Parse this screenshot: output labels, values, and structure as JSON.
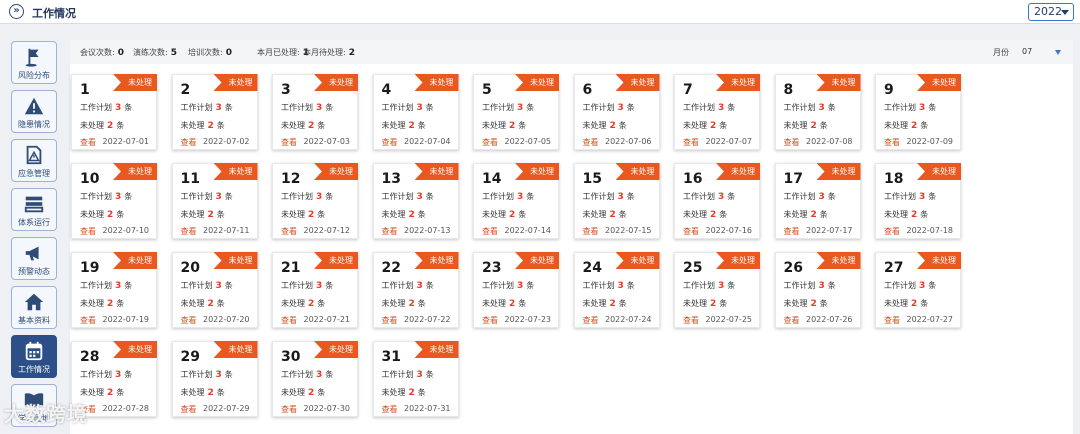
{
  "header": {
    "title": "工作情况",
    "year": "2022"
  },
  "sidebar": [
    {
      "label": "风险分布",
      "icon": "flag-icon"
    },
    {
      "label": "隐患情况",
      "icon": "warning-icon"
    },
    {
      "label": "应急管理",
      "icon": "document-alert-icon"
    },
    {
      "label": "体系运行",
      "icon": "server-stack-icon"
    },
    {
      "label": "预警动态",
      "icon": "megaphone-icon"
    },
    {
      "label": "基本资料",
      "icon": "home-icon"
    },
    {
      "label": "工作情况",
      "icon": "calendar-icon",
      "active": true
    },
    {
      "label": "学习园地",
      "icon": "book-icon"
    }
  ],
  "stats": [
    {
      "label": "会议次数:",
      "value": "0"
    },
    {
      "label": "演练次数:",
      "value": "5"
    },
    {
      "label": "培训次数:",
      "value": "0"
    },
    {
      "label": "本月已处理:",
      "value": "1"
    },
    {
      "label": "本月待处理:",
      "value": "2"
    }
  ],
  "month": {
    "label": "月份",
    "value": "07"
  },
  "card_text": {
    "badge": "未处理",
    "plan_prefix": "工作计划",
    "unit": "条",
    "pending_prefix": "未处理",
    "view": "查看"
  },
  "days": [
    {
      "day": "1",
      "plan": "3",
      "pending": "2",
      "date": "2022-07-01"
    },
    {
      "day": "2",
      "plan": "3",
      "pending": "2",
      "date": "2022-07-02"
    },
    {
      "day": "3",
      "plan": "3",
      "pending": "2",
      "date": "2022-07-03"
    },
    {
      "day": "4",
      "plan": "3",
      "pending": "2",
      "date": "2022-07-04"
    },
    {
      "day": "5",
      "plan": "3",
      "pending": "2",
      "date": "2022-07-05"
    },
    {
      "day": "6",
      "plan": "3",
      "pending": "2",
      "date": "2022-07-06"
    },
    {
      "day": "7",
      "plan": "3",
      "pending": "2",
      "date": "2022-07-07"
    },
    {
      "day": "8",
      "plan": "3",
      "pending": "2",
      "date": "2022-07-08"
    },
    {
      "day": "9",
      "plan": "3",
      "pending": "2",
      "date": "2022-07-09"
    },
    {
      "day": "10",
      "plan": "3",
      "pending": "2",
      "date": "2022-07-10"
    },
    {
      "day": "11",
      "plan": "3",
      "pending": "2",
      "date": "2022-07-11"
    },
    {
      "day": "12",
      "plan": "3",
      "pending": "2",
      "date": "2022-07-12"
    },
    {
      "day": "13",
      "plan": "3",
      "pending": "2",
      "date": "2022-07-13"
    },
    {
      "day": "14",
      "plan": "3",
      "pending": "2",
      "date": "2022-07-14"
    },
    {
      "day": "15",
      "plan": "3",
      "pending": "2",
      "date": "2022-07-15"
    },
    {
      "day": "16",
      "plan": "3",
      "pending": "2",
      "date": "2022-07-16"
    },
    {
      "day": "17",
      "plan": "3",
      "pending": "2",
      "date": "2022-07-17"
    },
    {
      "day": "18",
      "plan": "3",
      "pending": "2",
      "date": "2022-07-18"
    },
    {
      "day": "19",
      "plan": "3",
      "pending": "2",
      "date": "2022-07-19"
    },
    {
      "day": "20",
      "plan": "3",
      "pending": "2",
      "date": "2022-07-20"
    },
    {
      "day": "21",
      "plan": "3",
      "pending": "2",
      "date": "2022-07-21"
    },
    {
      "day": "22",
      "plan": "3",
      "pending": "2",
      "date": "2022-07-22"
    },
    {
      "day": "23",
      "plan": "3",
      "pending": "2",
      "date": "2022-07-23"
    },
    {
      "day": "24",
      "plan": "3",
      "pending": "2",
      "date": "2022-07-24"
    },
    {
      "day": "25",
      "plan": "3",
      "pending": "2",
      "date": "2022-07-25"
    },
    {
      "day": "26",
      "plan": "3",
      "pending": "2",
      "date": "2022-07-26"
    },
    {
      "day": "27",
      "plan": "3",
      "pending": "2",
      "date": "2022-07-27"
    },
    {
      "day": "28",
      "plan": "3",
      "pending": "2",
      "date": "2022-07-28"
    },
    {
      "day": "29",
      "plan": "3",
      "pending": "2",
      "date": "2022-07-29"
    },
    {
      "day": "30",
      "plan": "3",
      "pending": "2",
      "date": "2022-07-30"
    },
    {
      "day": "31",
      "plan": "3",
      "pending": "2",
      "date": "2022-07-31"
    }
  ],
  "watermark": "大数跨境",
  "colors": {
    "badge": "#e8581f",
    "count": "#e23b2a",
    "nav_active": "#2b4f86",
    "accent": "#3a78c2"
  }
}
